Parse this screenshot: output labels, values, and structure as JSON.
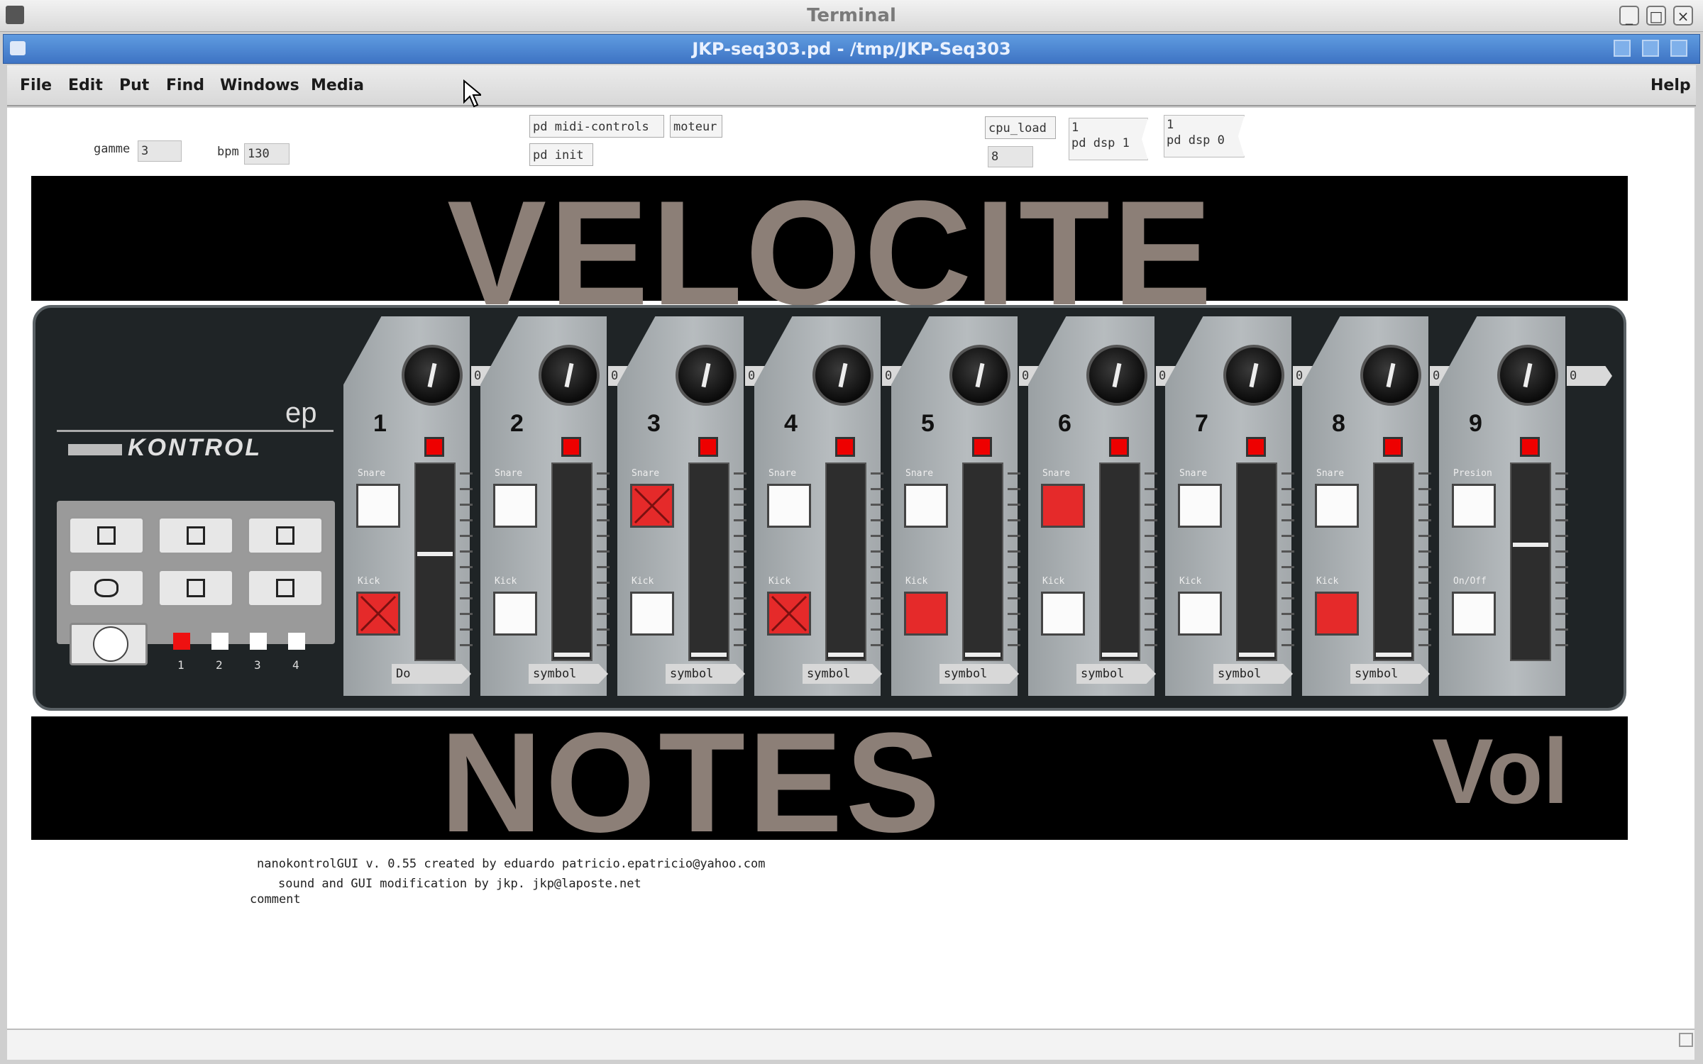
{
  "outer_window": {
    "title": "Terminal",
    "min": "_",
    "max": "□",
    "close": "×"
  },
  "pd_window": {
    "title": "JKP-seq303.pd - /tmp/JKP-Seq303"
  },
  "menu": {
    "file": "File",
    "edit": "Edit",
    "put": "Put",
    "find": "Find",
    "windows": "Windows",
    "media": "Media",
    "help": "Help"
  },
  "canvas_objects": {
    "gamme_label": "gamme",
    "gamme_value": "3",
    "bpm_label": "bpm",
    "bpm_value": "130",
    "midi_controls": "pd midi-controls",
    "moteur": "moteur",
    "pd_init": "pd init",
    "cpu_load": "cpu_load",
    "cpu_value": "8",
    "dsp_on_msg_1": "1",
    "dsp_on_msg_2": "pd dsp 1",
    "dsp_off_msg_1": "1",
    "dsp_off_msg_2": "pd dsp 0"
  },
  "banners": {
    "top": "VELOCITE",
    "bottom": "NOTES",
    "vol": "Vol"
  },
  "controller": {
    "brand_ep": "ep",
    "brand_logo": "KONTROL",
    "scene_labels": [
      "1",
      "2",
      "3",
      "4"
    ],
    "strips": [
      {
        "num": "1",
        "top_label": "Snare",
        "bottom_label": "Kick",
        "top_state": "white",
        "bottom_state": "red-x",
        "knob_val": "0",
        "symbol": "Do",
        "slider": 0.55
      },
      {
        "num": "2",
        "top_label": "Snare",
        "bottom_label": "Kick",
        "top_state": "white",
        "bottom_state": "white",
        "knob_val": "0",
        "symbol": "symbol",
        "slider": 0.0
      },
      {
        "num": "3",
        "top_label": "Snare",
        "bottom_label": "Kick",
        "top_state": "red-x",
        "bottom_state": "white",
        "knob_val": "0",
        "symbol": "symbol",
        "slider": 0.0
      },
      {
        "num": "4",
        "top_label": "Snare",
        "bottom_label": "Kick",
        "top_state": "white",
        "bottom_state": "red-x",
        "knob_val": "0",
        "symbol": "symbol",
        "slider": 0.0
      },
      {
        "num": "5",
        "top_label": "Snare",
        "bottom_label": "Kick",
        "top_state": "white",
        "bottom_state": "red",
        "knob_val": "0",
        "symbol": "symbol",
        "slider": 0.0
      },
      {
        "num": "6",
        "top_label": "Snare",
        "bottom_label": "Kick",
        "top_state": "red",
        "bottom_state": "white",
        "knob_val": "0",
        "symbol": "symbol",
        "slider": 0.0
      },
      {
        "num": "7",
        "top_label": "Snare",
        "bottom_label": "Kick",
        "top_state": "white",
        "bottom_state": "white",
        "knob_val": "0",
        "symbol": "symbol",
        "slider": 0.0
      },
      {
        "num": "8",
        "top_label": "Snare",
        "bottom_label": "Kick",
        "top_state": "white",
        "bottom_state": "red",
        "knob_val": "0",
        "symbol": "symbol",
        "slider": 0.0
      },
      {
        "num": "9",
        "top_label": "Presion",
        "bottom_label": "On/Off",
        "top_state": "white",
        "bottom_state": "white",
        "knob_val": "0",
        "symbol": "",
        "slider": 0.6
      }
    ]
  },
  "credits": {
    "line1": "nanokontrolGUI v. 0.55 created by eduardo patricio.epatricio@yahoo.com",
    "line2": "sound and GUI modification by jkp. jkp@laposte.net",
    "line3": "comment"
  },
  "colors": {
    "banner_text": "#8c7f77",
    "red": "#e52a2a",
    "title_blue": "#3e74c4"
  }
}
